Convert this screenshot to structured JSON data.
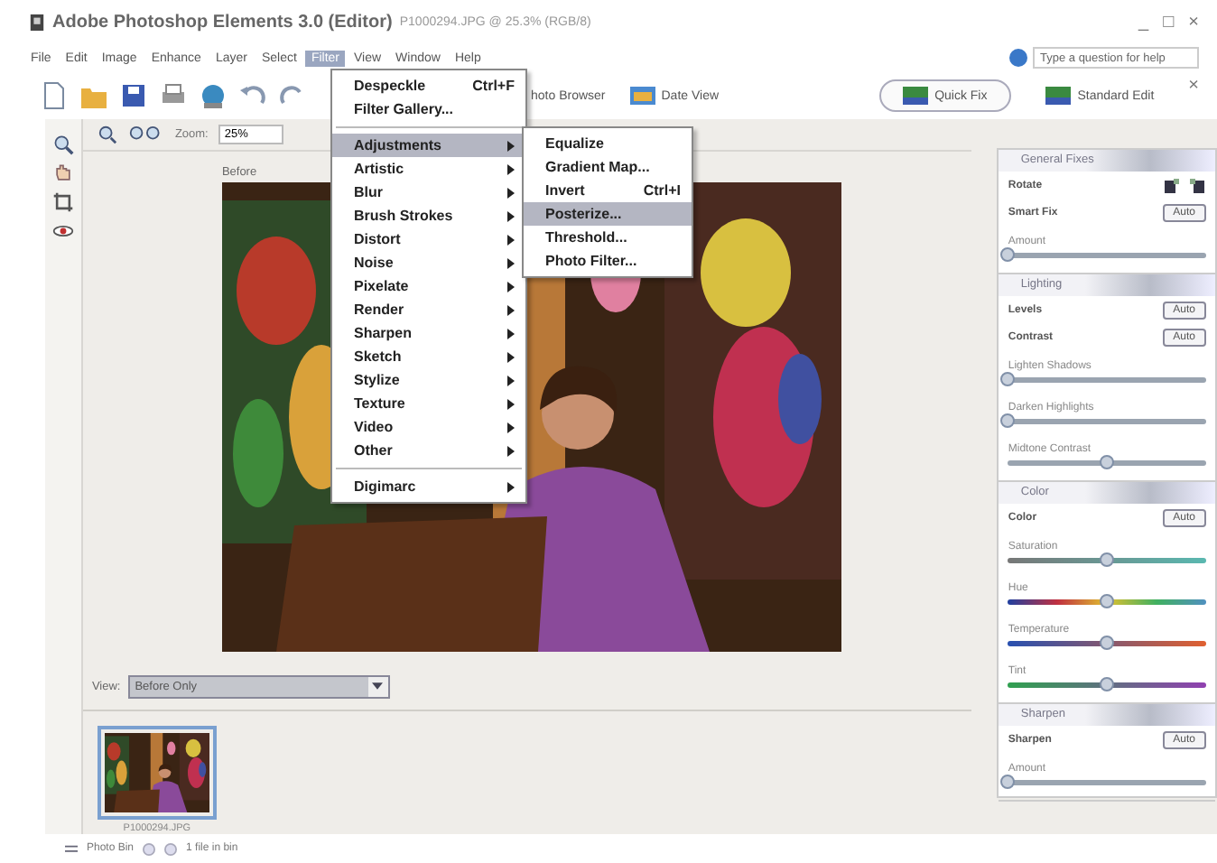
{
  "window": {
    "title": "Adobe Photoshop Elements 3.0 (Editor)",
    "document": "P1000294.JPG @ 25.3% (RGB/8)",
    "controls": [
      "_",
      "□",
      "×"
    ]
  },
  "menu_bar": [
    {
      "label": "File",
      "selected": false
    },
    {
      "label": "Edit",
      "selected": false
    },
    {
      "label": "Image",
      "selected": false
    },
    {
      "label": "Enhance",
      "selected": false
    },
    {
      "label": "Layer",
      "selected": false
    },
    {
      "label": "Select",
      "selected": false
    },
    {
      "label": "Filter",
      "selected": true
    },
    {
      "label": "View",
      "selected": false
    },
    {
      "label": "Window",
      "selected": false
    },
    {
      "label": "Help",
      "selected": false
    }
  ],
  "toolbar": {
    "buttons": [
      "hoto Browser",
      "Date View"
    ],
    "help_field": {
      "placeholder": "Type a question for help"
    },
    "close": "×",
    "modes": [
      {
        "label": "Quick Fix",
        "selected": true
      },
      {
        "label": "Standard Edit",
        "selected": false
      }
    ]
  },
  "zoom_bar": {
    "label": "Zoom:",
    "value": "25%"
  },
  "canvas": {
    "label": "Before",
    "view_label": "View:",
    "view_value": "Before Only"
  },
  "photo_bin": {
    "items": [
      {
        "caption": "P1000294.JPG",
        "selected": true
      }
    ]
  },
  "status_bar": {
    "label": "Photo Bin",
    "info": "1 file in bin"
  },
  "filter_menu": {
    "sections": [
      [
        {
          "label": "Despeckle",
          "shortcut": "Ctrl+F",
          "submenu": false,
          "selected": false
        },
        {
          "label": "Filter Gallery...",
          "submenu": false,
          "selected": false
        }
      ],
      [
        {
          "label": "Adjustments",
          "submenu": true,
          "selected": true
        },
        {
          "label": "Artistic",
          "submenu": true,
          "selected": false
        },
        {
          "label": "Blur",
          "submenu": true,
          "selected": false
        },
        {
          "label": "Brush Strokes",
          "submenu": true,
          "selected": false
        },
        {
          "label": "Distort",
          "submenu": true,
          "selected": false
        },
        {
          "label": "Noise",
          "submenu": true,
          "selected": false
        },
        {
          "label": "Pixelate",
          "submenu": true,
          "selected": false
        },
        {
          "label": "Render",
          "submenu": true,
          "selected": false
        },
        {
          "label": "Sharpen",
          "submenu": true,
          "selected": false
        },
        {
          "label": "Sketch",
          "submenu": true,
          "selected": false
        },
        {
          "label": "Stylize",
          "submenu": true,
          "selected": false
        },
        {
          "label": "Texture",
          "submenu": true,
          "selected": false
        },
        {
          "label": "Video",
          "submenu": true,
          "selected": false
        },
        {
          "label": "Other",
          "submenu": true,
          "selected": false
        }
      ],
      [
        {
          "label": "Digimarc",
          "submenu": true,
          "selected": false
        }
      ]
    ]
  },
  "submenu": {
    "items": [
      {
        "label": "Equalize",
        "selected": false
      },
      {
        "label": "Gradient Map...",
        "selected": false
      },
      {
        "label": "Invert",
        "shortcut": "Ctrl+I",
        "selected": false
      },
      {
        "label": "Posterize...",
        "selected": true
      },
      {
        "label": "Threshold...",
        "selected": false
      },
      {
        "label": "Photo Filter...",
        "selected": false
      }
    ]
  },
  "palette": {
    "sections": [
      {
        "title": "General Fixes",
        "rows": [
          {
            "kind": "icons",
            "label": "Rotate"
          },
          {
            "kind": "button",
            "label": "Smart Fix",
            "button": "Auto"
          },
          {
            "kind": "slider",
            "label": "Amount",
            "level": 0
          }
        ]
      },
      {
        "title": "Lighting",
        "rows": [
          {
            "kind": "button",
            "label": "Levels",
            "button": "Auto"
          },
          {
            "kind": "button",
            "label": "Contrast",
            "button": "Auto"
          },
          {
            "kind": "slider",
            "label": "Lighten Shadows",
            "level": 0
          },
          {
            "kind": "slider",
            "label": "Darken Highlights",
            "level": 0
          },
          {
            "kind": "slider",
            "label": "Midtone Contrast",
            "level": 0.5
          }
        ]
      },
      {
        "title": "Color",
        "rows": [
          {
            "kind": "button",
            "label": "Color",
            "button": "Auto"
          },
          {
            "kind": "saturation",
            "label": "Saturation",
            "level": 0.5
          },
          {
            "kind": "hue",
            "label": "Hue",
            "level": 0.5
          },
          {
            "kind": "temperature",
            "label": "Temperature",
            "level": 0.5
          },
          {
            "kind": "tint",
            "label": "Tint",
            "level": 0.5
          }
        ]
      },
      {
        "title": "Sharpen",
        "rows": [
          {
            "kind": "button",
            "label": "Sharpen",
            "button": "Auto"
          },
          {
            "kind": "slider",
            "label": "Amount",
            "level": 0
          }
        ]
      }
    ]
  }
}
